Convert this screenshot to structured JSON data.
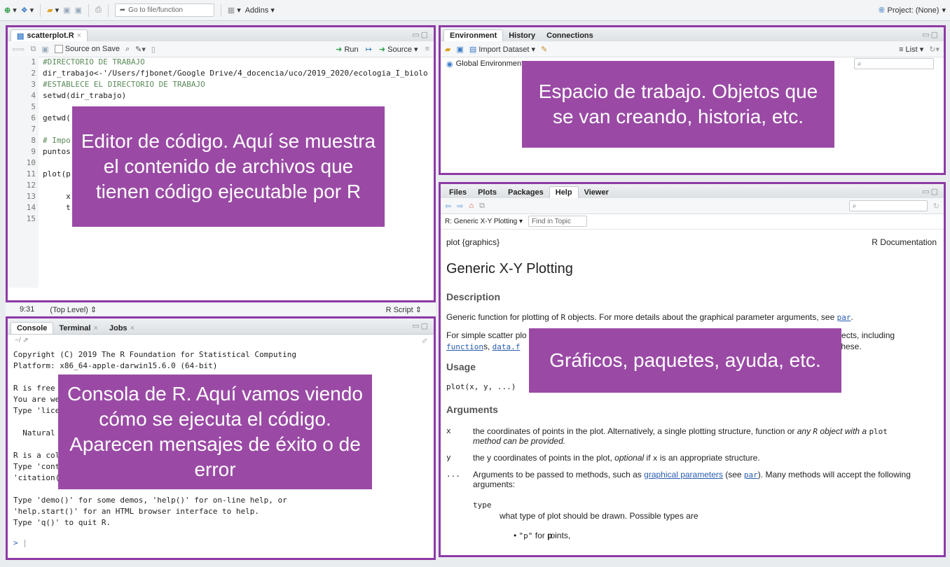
{
  "topbar": {
    "goto_placeholder": "Go to file/function",
    "addins": "Addins",
    "project": "Project: (None)"
  },
  "editor": {
    "tab": "scatterplot.R",
    "source_on_save": "Source on Save",
    "run": "Run",
    "source": "Source",
    "line_numbers": [
      "1",
      "2",
      "3",
      "4",
      "5",
      "6",
      "7",
      "8",
      "9",
      "10",
      "11",
      "12",
      "13",
      "14",
      "15"
    ],
    "lines": [
      "#DIRECTORIO DE TRABAJO",
      "dir_trabajo<-'/Users/fjbonet/Google Drive/4_docencia/uco/2019_2020/ecologia_I_biolo",
      "#ESTABLECE EL DIRECTORIO DE TRABAJO",
      "setwd(dir_trabajo)",
      "",
      "getwd(",
      "",
      "# Impo",
      "puntos",
      "",
      "plot(p                                                  ratura vs P",
      "",
      "     x                                                  ,",
      "     t                                                  untos_clima",
      ""
    ],
    "status_pos": "9:31",
    "status_level": "(Top Level)",
    "status_type": "R Script"
  },
  "environment": {
    "tabs": [
      "Environment",
      "History",
      "Connections"
    ],
    "import_dataset": "Import Dataset",
    "list": "List",
    "global_env": "Global Environment"
  },
  "console": {
    "tabs": [
      "Console",
      "Terminal",
      "Jobs"
    ],
    "path": "~/",
    "lines": [
      "Copyright (C) 2019 The R Foundation for Statistical Computing",
      "Platform: x86_64-apple-darwin15.6.0 (64-bit)",
      "",
      "R is free",
      "You are we",
      "Type 'lice",
      "",
      "  Natural",
      "",
      "R is a col",
      "Type 'cont",
      "'citation(",
      "",
      "Type 'demo()' for some demos, 'help()' for on-line help, or",
      "'help.start()' for an HTML browser interface to help.",
      "Type 'q()' to quit R.",
      "",
      ""
    ],
    "prompt": ">"
  },
  "files": {
    "tabs": [
      "Files",
      "Plots",
      "Packages",
      "Help",
      "Viewer"
    ],
    "topic": "R: Generic X-Y Plotting",
    "find_placeholder": "Find in Topic",
    "help": {
      "pkg": "plot {graphics}",
      "doc": "R Documentation",
      "title": "Generic X-Y Plotting",
      "description_h": "Description",
      "desc_pre": "Generic function for plotting of ",
      "desc_r": "R",
      "desc_mid": " objects. For more details about the graphical parameter arguments, see ",
      "desc_par": "par",
      "desc_end": ".",
      "simple_pre": "For simple scatter plo",
      "simple_end": "objects, including",
      "functions_link": "function",
      "functions_s": "s, ",
      "dataf_link": "data.f",
      "these": "these.",
      "usage_h": "Usage",
      "usage": "plot(x, y, ...)",
      "args_h": "Arguments",
      "arg_x": "x",
      "arg_x_desc": "the coordinates of points in the plot. Alternatively, a single plotting structure, function or",
      "arg_x_any": "any",
      "arg_x_r": "R",
      "arg_x_obj": "object with a",
      "arg_x_plot": "plot",
      "arg_x_method": "method can be provided.",
      "arg_y": "y",
      "arg_y_pre": "the y coordinates of points in the plot,",
      "arg_y_opt": "optional",
      "arg_y_if": "if",
      "arg_y_x": "x",
      "arg_y_end": "is an appropriate structure.",
      "arg_dots": "...",
      "arg_dots_pre": "Arguments to be passed to methods, such as",
      "arg_dots_link": "graphical parameters",
      "arg_dots_see": "(see",
      "arg_dots_par": "par",
      "arg_dots_end": "). Many methods will accept the following arguments:",
      "type_kw": "type",
      "type_desc": "what type of plot should be drawn. Possible types are",
      "bullet_p": "\"p\"",
      "bullet_p_for": "for",
      "bullet_p_b": "p",
      "bullet_p_end": "oints,"
    }
  },
  "overlays": {
    "editor": "Editor de código. Aquí se muestra el contenido de archivos que tienen código ejecutable por R",
    "environment": "Espacio de trabajo. Objetos que se van creando, historia, etc.",
    "console": "Consola de R. Aquí vamos viendo cómo se ejecuta el código. Aparecen mensajes de éxito o de error",
    "files": "Gráficos, paquetes, ayuda, etc."
  },
  "colors": {
    "highlight_border": "#8e3aa6",
    "overlay_bg": "#9a4aa5"
  }
}
